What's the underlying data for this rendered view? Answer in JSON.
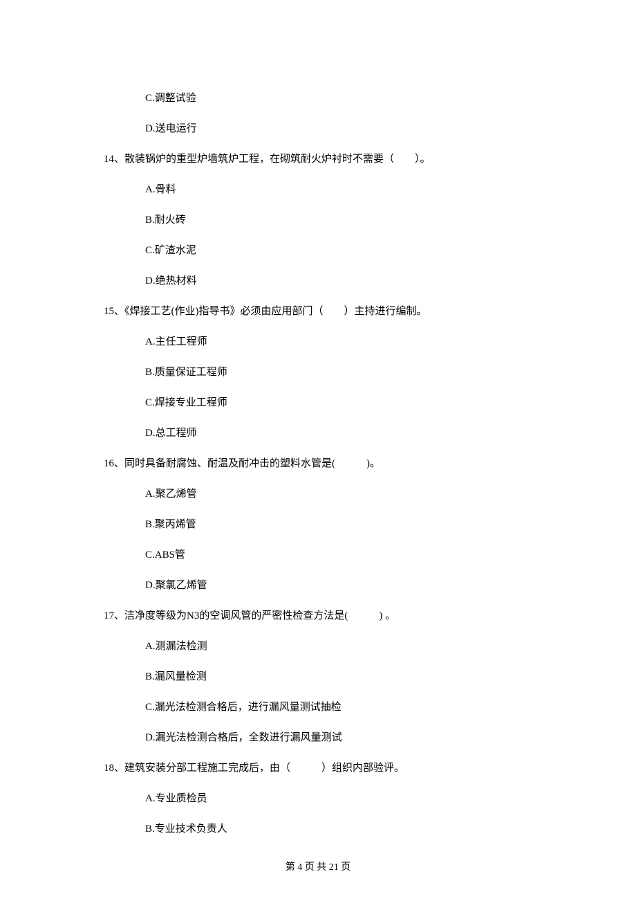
{
  "q13": {
    "options": {
      "c": "C.调整试验",
      "d": "D.送电运行"
    }
  },
  "q14": {
    "stem": "14、散装锅炉的重型炉墙筑炉工程，在砌筑耐火炉衬时不需要（　　）。",
    "options": {
      "a": "A.骨料",
      "b": "B.耐火砖",
      "c": "C.矿渣水泥",
      "d": "D.绝热材料"
    }
  },
  "q15": {
    "stem": "15、《焊接工艺(作业)指导书》必须由应用部门（　　）主持进行编制。",
    "options": {
      "a": "A.主任工程师",
      "b": "B.质量保证工程师",
      "c": "C.焊接专业工程师",
      "d": "D.总工程师"
    }
  },
  "q16": {
    "stem": "16、同时具备耐腐蚀、耐温及耐冲击的塑料水管是(　　　)。",
    "options": {
      "a": "A.聚乙烯管",
      "b": "B.聚丙烯管",
      "c": "C.ABS管",
      "d": "D.聚氯乙烯管"
    }
  },
  "q17": {
    "stem": "17、洁净度等级为N3的空调风管的严密性检查方法是(　　　) 。",
    "options": {
      "a": "A.测漏法检测",
      "b": "B.漏风量检测",
      "c": "C.漏光法检测合格后，进行漏风量测试抽检",
      "d": "D.漏光法检测合格后，全数进行漏风量测试"
    }
  },
  "q18": {
    "stem": "18、建筑安装分部工程施工完成后，由（　　　）组织内部验评。",
    "options": {
      "a": "A.专业质检员",
      "b": "B.专业技术负责人"
    }
  },
  "footer": "第 4 页 共 21 页"
}
